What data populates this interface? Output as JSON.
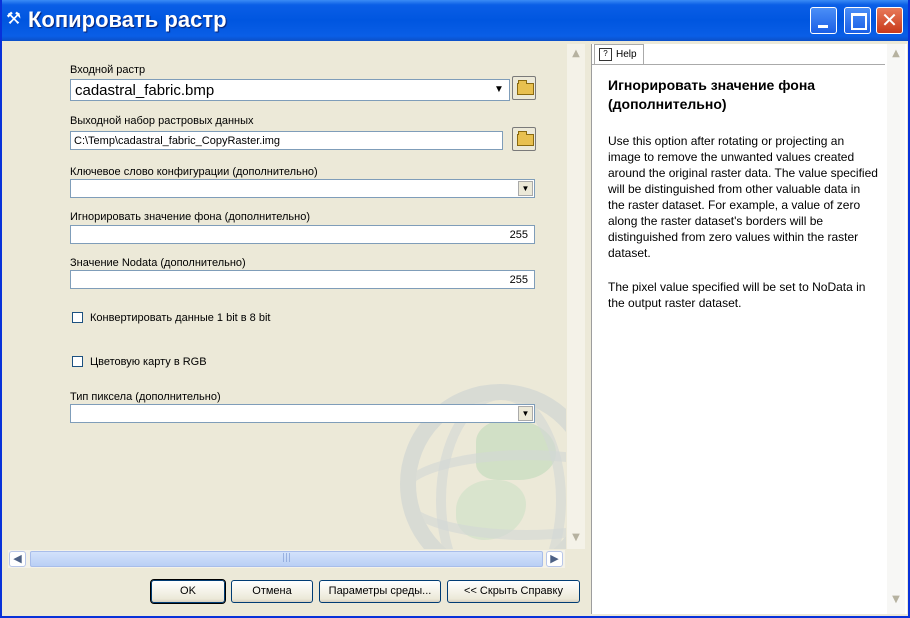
{
  "window": {
    "title": "Копировать растр",
    "icon": "hammer-icon"
  },
  "form": {
    "input_raster": {
      "label": "Входной растр",
      "value": "cadastral_fabric.bmp"
    },
    "output_raster": {
      "label": "Выходной набор растровых данных",
      "value": "C:\\Temp\\cadastral_fabric_CopyRaster.img"
    },
    "config_keyword": {
      "label": "Ключевое слово конфигурации (дополнительно)",
      "value": ""
    },
    "ignore_background": {
      "label": "Игнорировать значение фона (дополнительно)",
      "value": "255"
    },
    "nodata_value": {
      "label": "Значение Nodata  (дополнительно)",
      "value": "255"
    },
    "convert_1bit": {
      "label": "Конвертировать данные 1 bit в 8 bit",
      "checked": false
    },
    "colormap_rgb": {
      "label": "Цветовую карту в RGB",
      "checked": false
    },
    "pixel_type": {
      "label": "Тип пиксела (дополнительно)",
      "value": ""
    }
  },
  "buttons": {
    "ok": "OK",
    "cancel": "Отмена",
    "environments": "Параметры среды...",
    "hide_help": "<< Скрыть Справку"
  },
  "help": {
    "tab_label": "Help",
    "title": "Игнорировать значение фона (дополнительно)",
    "paragraph1": "Use this option after rotating or projecting an image to remove the unwanted values created around the original raster data. The value specified will be distinguished from other valuable data in the raster dataset. For example, a value of zero along the raster dataset's borders will be distinguished from zero values within the raster dataset.",
    "paragraph2": "The pixel value specified will be set to NoData in the output raster dataset."
  }
}
